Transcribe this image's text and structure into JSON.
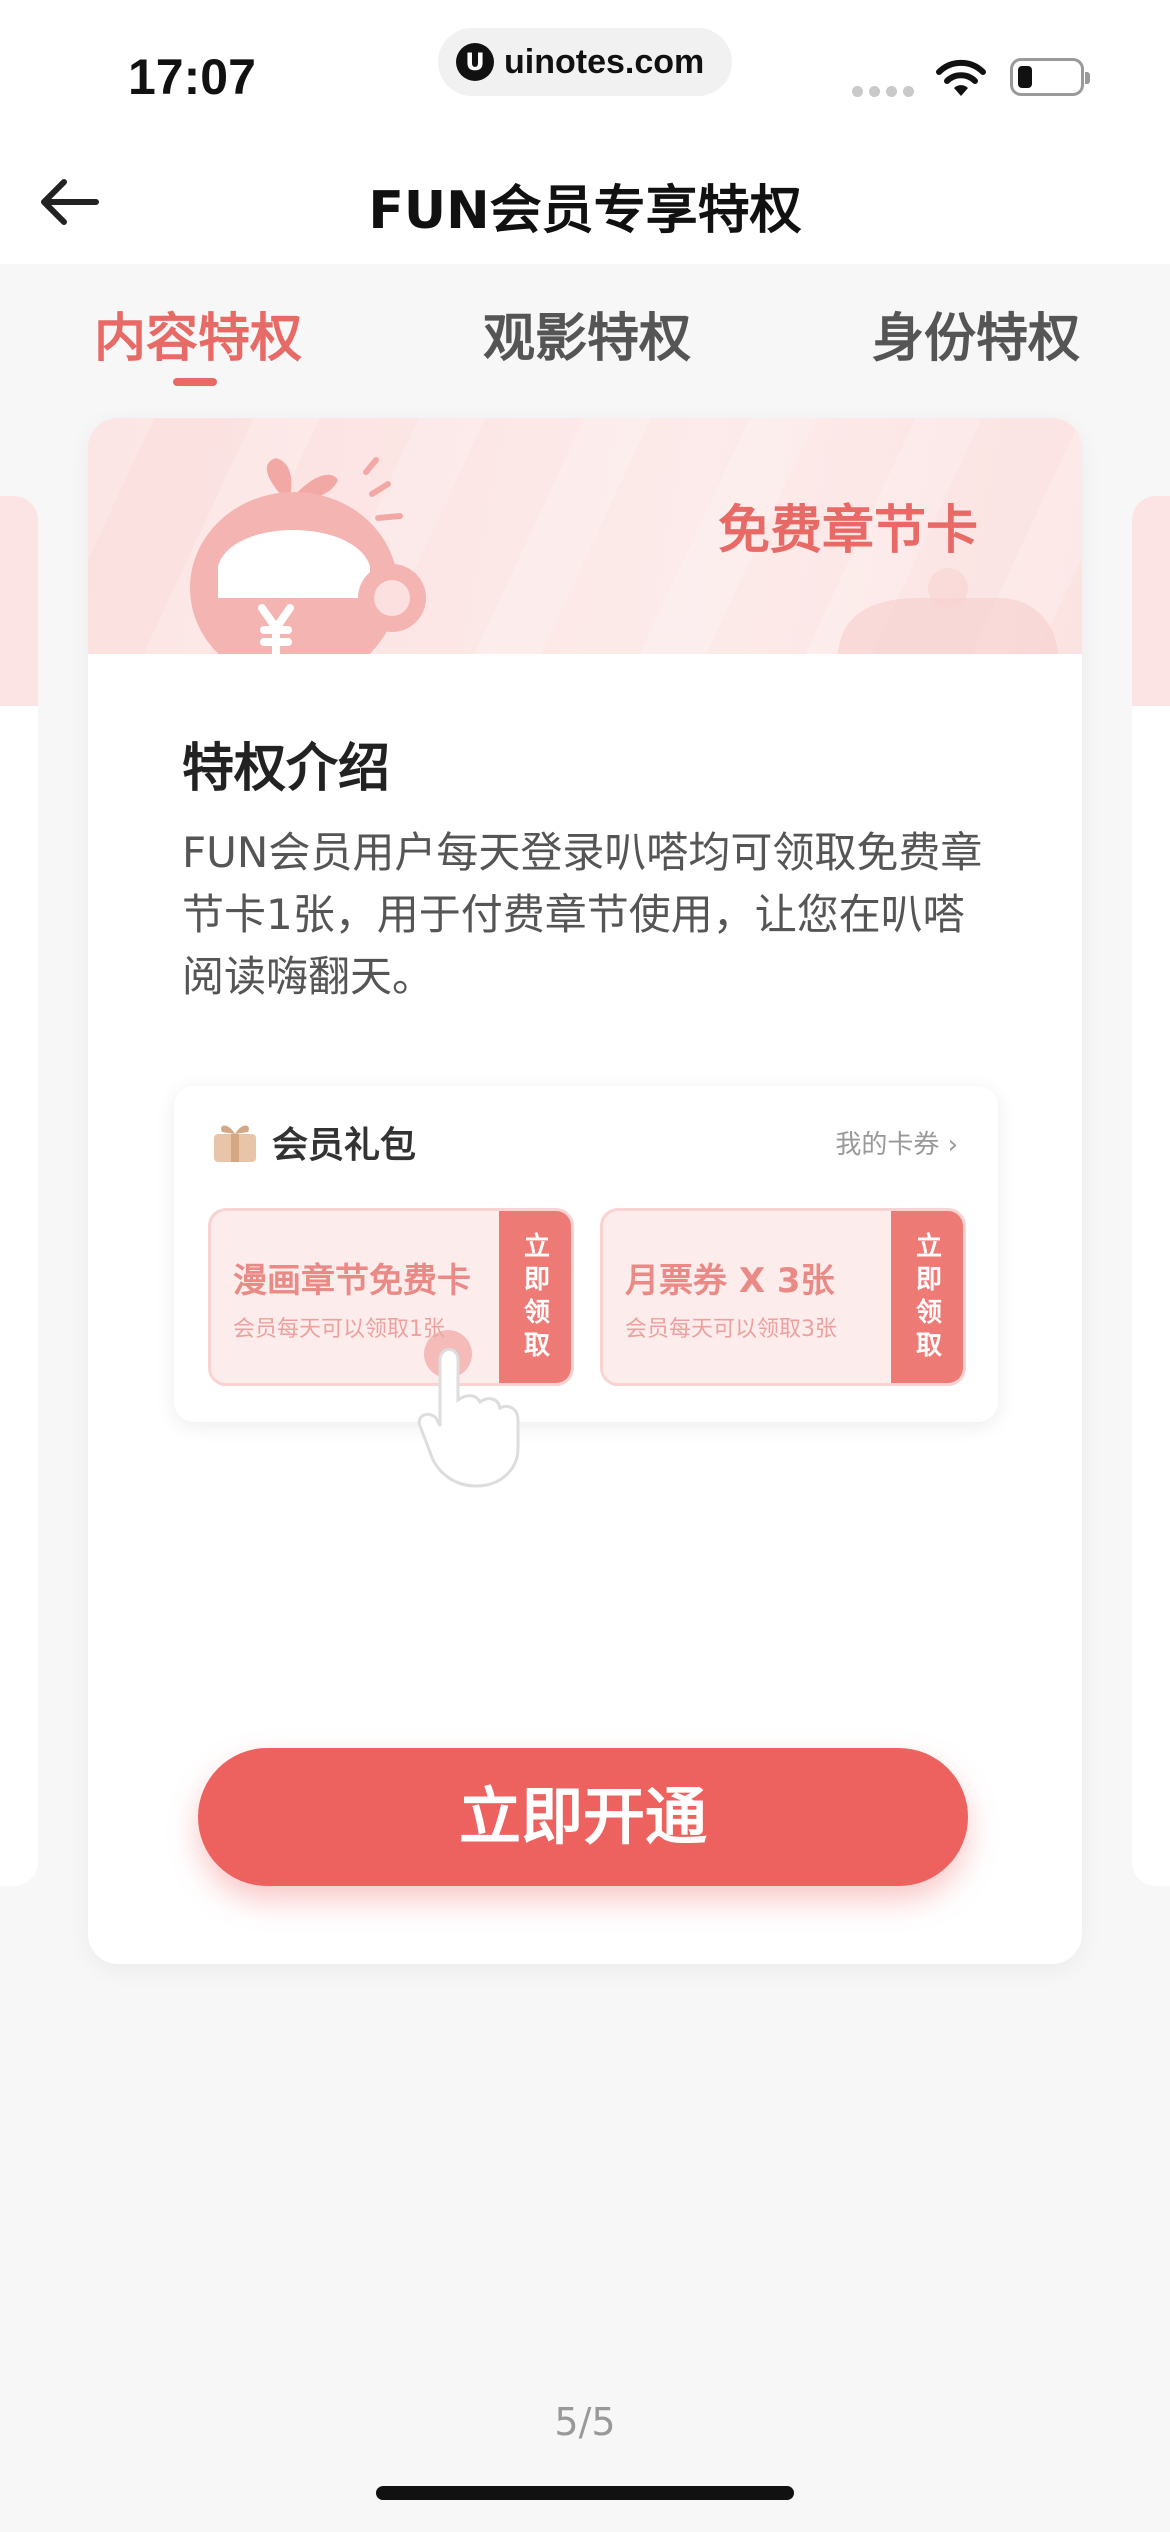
{
  "status_bar": {
    "time": "17:07",
    "url": "uinotes.com",
    "url_logo": "U"
  },
  "nav": {
    "title": "FUN会员专享特权",
    "back_icon": "arrow-left-icon"
  },
  "tabs": [
    {
      "label": "内容特权",
      "active": true
    },
    {
      "label": "观影特权",
      "active": false
    },
    {
      "label": "身份特权",
      "active": false
    }
  ],
  "card": {
    "banner_title": "免费章节卡",
    "section_title": "特权介绍",
    "description": "FUN会员用户每天登录叭嗒均可领取免费章节卡1张，用于付费章节使用，让您在叭嗒阅读嗨翻天。",
    "gift": {
      "title": "会员礼包",
      "link": "我的卡券 ›",
      "coupons": [
        {
          "name": "漫画章节免费卡",
          "sub": "会员每天可以领取1张",
          "button": "立即领取"
        },
        {
          "name": "月票券 X 3张",
          "sub": "会员每天可以领取3张",
          "button": "立即领取"
        }
      ]
    },
    "cta": "立即开通"
  },
  "pager": "5/5",
  "colors": {
    "accent": "#e86a66",
    "cta": "#ed625e",
    "banner": "#fbe0df"
  }
}
